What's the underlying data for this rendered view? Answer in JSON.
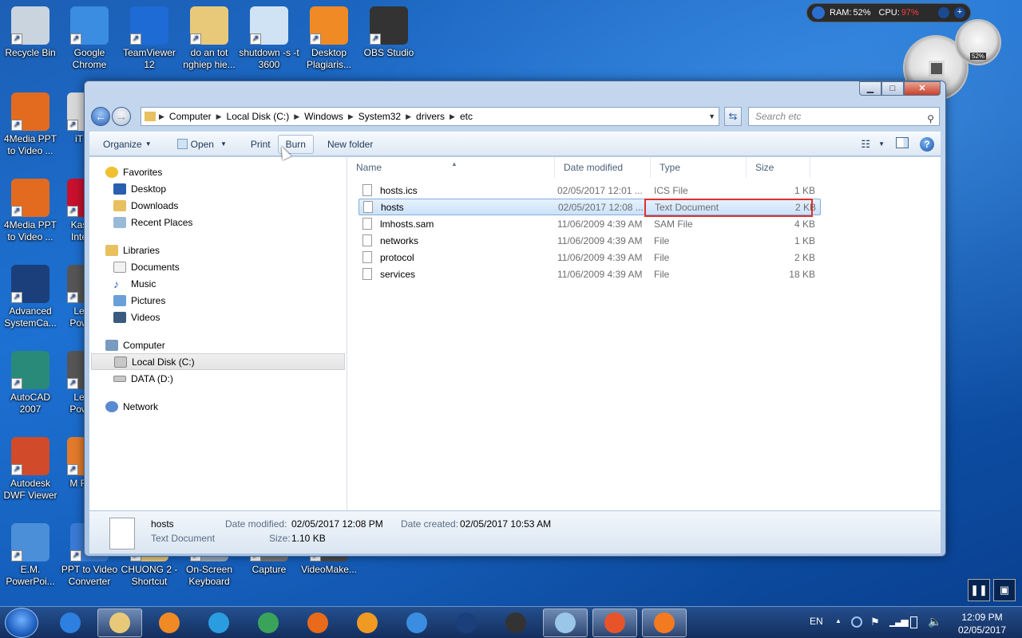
{
  "desktop": {
    "top_icons": [
      {
        "label": "Recycle Bin",
        "color": "#c9d4de"
      },
      {
        "label": "Google Chrome",
        "color": "#3a8de0"
      },
      {
        "label": "TeamViewer 12",
        "color": "#1e6bd6"
      },
      {
        "label": "do an tot nghiep hie...",
        "color": "#e8c97a"
      },
      {
        "label": "shutdown -s -t 3600",
        "color": "#cfe3f5"
      },
      {
        "label": "Desktop Plagiaris...",
        "color": "#f08a24"
      },
      {
        "label": "OBS Studio",
        "color": "#333333"
      }
    ],
    "left_icons": [
      {
        "label": "4Media PPT to Video ...",
        "color": "#e36b1f"
      },
      {
        "label": "4Media PPT to Video ...",
        "color": "#e36b1f"
      },
      {
        "label": "Advanced SystemCa...",
        "color": "#1b3f7a"
      },
      {
        "label": "AutoCAD 2007",
        "color": "#2a8a7a"
      },
      {
        "label": "Autodesk DWF Viewer",
        "color": "#d14a2a"
      },
      {
        "label": "E.M. PowerPoi...",
        "color": "#4a8fd8"
      }
    ],
    "partial_icons": [
      {
        "label": "iT",
        "color": "#d8d8d8"
      },
      {
        "label": "Kas Inte",
        "color": "#c8102e"
      },
      {
        "label": "Le Pow",
        "color": "#555555"
      },
      {
        "label": "Le Pow",
        "color": "#555555"
      },
      {
        "label": "M Fi",
        "color": "#e37a2a"
      }
    ],
    "bottom_icons": [
      {
        "label": "PPT to Video Converter",
        "color": "#3a7bd5"
      },
      {
        "label": "CHUONG 2 - Shortcut",
        "color": "#e8c97a"
      },
      {
        "label": "On-Screen Keyboard",
        "color": "#9aa9b8"
      },
      {
        "label": "Capture",
        "color": "#7a7a7a"
      },
      {
        "label": "VideoMake...",
        "color": "#4a4a4a"
      }
    ]
  },
  "gadget": {
    "ram_label": "RAM:",
    "ram_value": "52%",
    "cpu_label": "CPU:",
    "cpu_value": "97%",
    "cpu_color": "#ff4040",
    "gauge_small_value": "52%",
    "ram_fraction": 0.52,
    "cpu_fraction": 0.97
  },
  "window": {
    "controls": {
      "minimize": "▁",
      "maximize": "□",
      "close": "✕"
    },
    "breadcrumb": [
      "Computer",
      "Local Disk (C:)",
      "Windows",
      "System32",
      "drivers",
      "etc"
    ],
    "search_placeholder": "Search etc",
    "toolbar": {
      "organize": "Organize",
      "open": "Open",
      "print": "Print",
      "burn": "Burn",
      "new_folder": "New folder"
    },
    "nav": {
      "favorites": "Favorites",
      "desktop": "Desktop",
      "downloads": "Downloads",
      "recent": "Recent Places",
      "libraries": "Libraries",
      "documents": "Documents",
      "music": "Music",
      "pictures": "Pictures",
      "videos": "Videos",
      "computer": "Computer",
      "local_disk": "Local Disk (C:)",
      "data": "DATA (D:)",
      "network": "Network"
    },
    "columns": {
      "name": "Name",
      "date": "Date modified",
      "type": "Type",
      "size": "Size"
    },
    "files": [
      {
        "name": "hosts.ics",
        "date": "02/05/2017 12:01 ...",
        "type": "ICS File",
        "size": "1 KB"
      },
      {
        "name": "hosts",
        "date": "02/05/2017 12:08 ...",
        "type": "Text Document",
        "size": "2 KB"
      },
      {
        "name": "lmhosts.sam",
        "date": "11/06/2009 4:39 AM",
        "type": "SAM File",
        "size": "4 KB"
      },
      {
        "name": "networks",
        "date": "11/06/2009 4:39 AM",
        "type": "File",
        "size": "1 KB"
      },
      {
        "name": "protocol",
        "date": "11/06/2009 4:39 AM",
        "type": "File",
        "size": "2 KB"
      },
      {
        "name": "services",
        "date": "11/06/2009 4:39 AM",
        "type": "File",
        "size": "18 KB"
      }
    ],
    "details": {
      "name": "hosts",
      "type": "Text Document",
      "modified_label": "Date modified:",
      "modified_value": "02/05/2017 12:08 PM",
      "created_label": "Date created:",
      "created_value": "02/05/2017 10:53 AM",
      "size_label": "Size:",
      "size_value": "1.10 KB"
    }
  },
  "taskbar": {
    "language": "EN",
    "time": "12:09 PM",
    "date": "02/05/2017",
    "apps": [
      {
        "name": "internet-explorer-icon",
        "color": "#2d7fe0"
      },
      {
        "name": "explorer-icon",
        "color": "#e8c97a"
      },
      {
        "name": "media-player-icon",
        "color": "#f08a24"
      },
      {
        "name": "wifi-icon",
        "color": "#2a9de0"
      },
      {
        "name": "coccoc-icon",
        "color": "#3aa35a"
      },
      {
        "name": "firefox-icon",
        "color": "#e86a1a"
      },
      {
        "name": "app-s-icon",
        "color": "#f09a24"
      },
      {
        "name": "chrome-icon",
        "color": "#3a8de0"
      },
      {
        "name": "systemcare-icon",
        "color": "#1b3f7a"
      },
      {
        "name": "obs-icon",
        "color": "#333333"
      },
      {
        "name": "notepad-icon",
        "color": "#9ac6e8"
      },
      {
        "name": "app-s2-icon",
        "color": "#e8542a"
      },
      {
        "name": "xampp-icon",
        "color": "#f47a20"
      }
    ]
  }
}
